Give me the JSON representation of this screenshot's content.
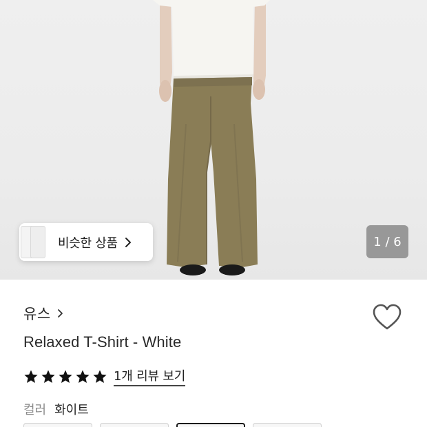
{
  "gallery": {
    "similar_label": "비슷한 상품",
    "counter": "1 / 6"
  },
  "product": {
    "brand": "유스",
    "title": "Relaxed T-Shirt - White",
    "rating_stars": 5,
    "review_link": "1개 리뷰 보기",
    "color_label": "컬러",
    "color_value": "화이트",
    "swatch_count": 4,
    "selected_swatch_index": 2
  },
  "colors": {
    "accent": "#1a1a1a",
    "star": "#111111",
    "pants": "#8a7d56",
    "tshirt": "#f6f5f1"
  }
}
